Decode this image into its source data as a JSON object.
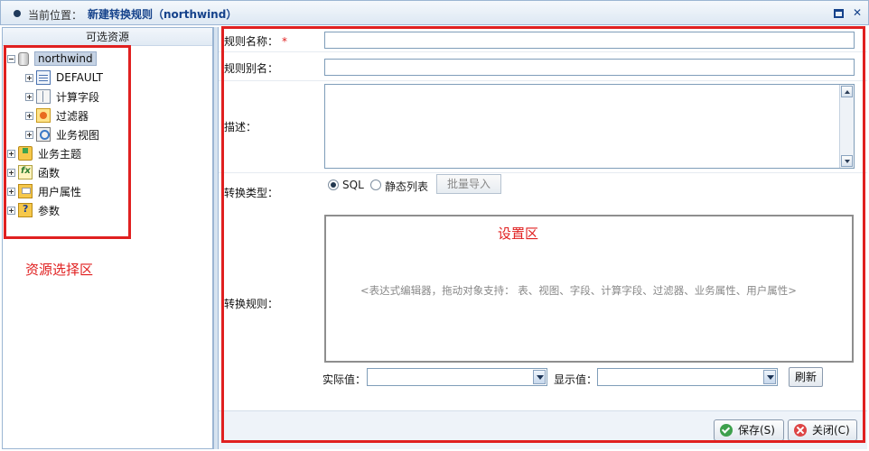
{
  "titlebar": {
    "location_label": "当前位置：",
    "location_value": "新建转换规则（northwind）",
    "maximize_icon": "maximize-icon",
    "close_glyph": "✕"
  },
  "left_panel": {
    "header": "可选资源",
    "tree": {
      "root": "northwind",
      "children": [
        "DEFAULT",
        "计算字段",
        "过滤器",
        "业务视图"
      ],
      "top_level": [
        "业务主题",
        "函数",
        "用户属性",
        "参数"
      ]
    },
    "annotation": "资源选择区"
  },
  "form": {
    "rule_name_label": "规则名称：",
    "required_mark": "*",
    "rule_alias_label": "规则别名：",
    "description_label": "描述：",
    "convert_type_label": "转换类型：",
    "type_sql": "SQL",
    "type_static": "静态列表",
    "bulk_import": "批量导入",
    "convert_rule_label": "转换规则：",
    "editor_zone": "设置区",
    "editor_hint": "<表达式编辑器，拖动对象支持：  表、视图、字段、计算字段、过滤器、业务属性、用户属性>",
    "actual_value_label": "实际值：",
    "display_value_label": "显示值：",
    "refresh": "刷新"
  },
  "footer": {
    "save": "保存(S)",
    "close": "关闭(C)"
  },
  "colors": {
    "accent": "#15428b",
    "annotation": "#e02020",
    "border": "#9bb5d3"
  }
}
